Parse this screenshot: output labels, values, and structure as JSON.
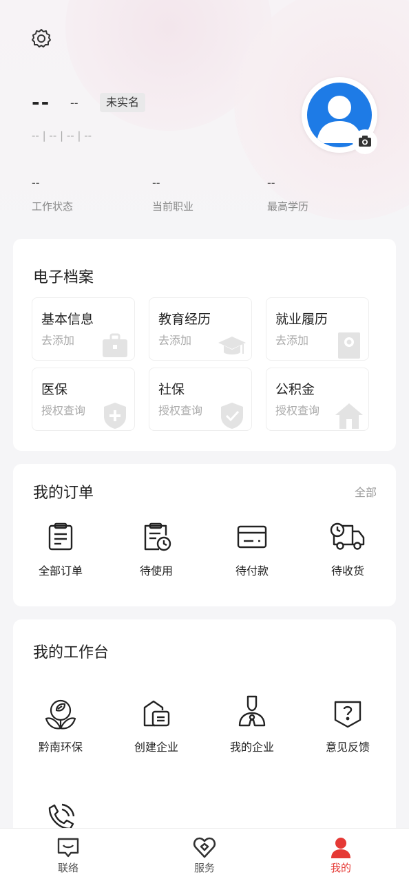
{
  "profile": {
    "name": "--",
    "name_sub": "--",
    "verify_badge": "未实名",
    "info_line": "-- | -- | -- | --"
  },
  "stats": [
    {
      "value": "--",
      "label": "工作状态"
    },
    {
      "value": "--",
      "label": "当前职业"
    },
    {
      "value": "--",
      "label": "最高学历"
    }
  ],
  "archive": {
    "title": "电子档案",
    "tiles": [
      {
        "title": "基本信息",
        "sub": "去添加",
        "icon": "briefcase-icon"
      },
      {
        "title": "教育经历",
        "sub": "去添加",
        "icon": "graduation-cap-icon"
      },
      {
        "title": "就业履历",
        "sub": "去添加",
        "icon": "certificate-icon"
      },
      {
        "title": "医保",
        "sub": "授权查询",
        "icon": "medical-shield-icon"
      },
      {
        "title": "社保",
        "sub": "授权查询",
        "icon": "check-shield-icon"
      },
      {
        "title": "公积金",
        "sub": "授权查询",
        "icon": "house-icon"
      }
    ]
  },
  "orders": {
    "title": "我的订单",
    "more": "全部",
    "items": [
      {
        "label": "全部订单",
        "icon": "clipboard-icon"
      },
      {
        "label": "待使用",
        "icon": "clipboard-clock-icon"
      },
      {
        "label": "待付款",
        "icon": "card-icon"
      },
      {
        "label": "待收货",
        "icon": "truck-icon"
      }
    ]
  },
  "workbench": {
    "title": "我的工作台",
    "items": [
      {
        "label": "黔南环保",
        "icon": "eco-leaf-icon"
      },
      {
        "label": "创建企业",
        "icon": "create-company-icon"
      },
      {
        "label": "我的企业",
        "icon": "my-company-icon"
      },
      {
        "label": "意见反馈",
        "icon": "feedback-icon"
      }
    ]
  },
  "tabs": [
    {
      "label": "联络",
      "icon": "chat-icon",
      "active": false
    },
    {
      "label": "服务",
      "icon": "heart-service-icon",
      "active": false
    },
    {
      "label": "我的",
      "icon": "person-icon",
      "active": true
    }
  ],
  "colors": {
    "accent": "#e53935",
    "avatar": "#1e7be6"
  }
}
